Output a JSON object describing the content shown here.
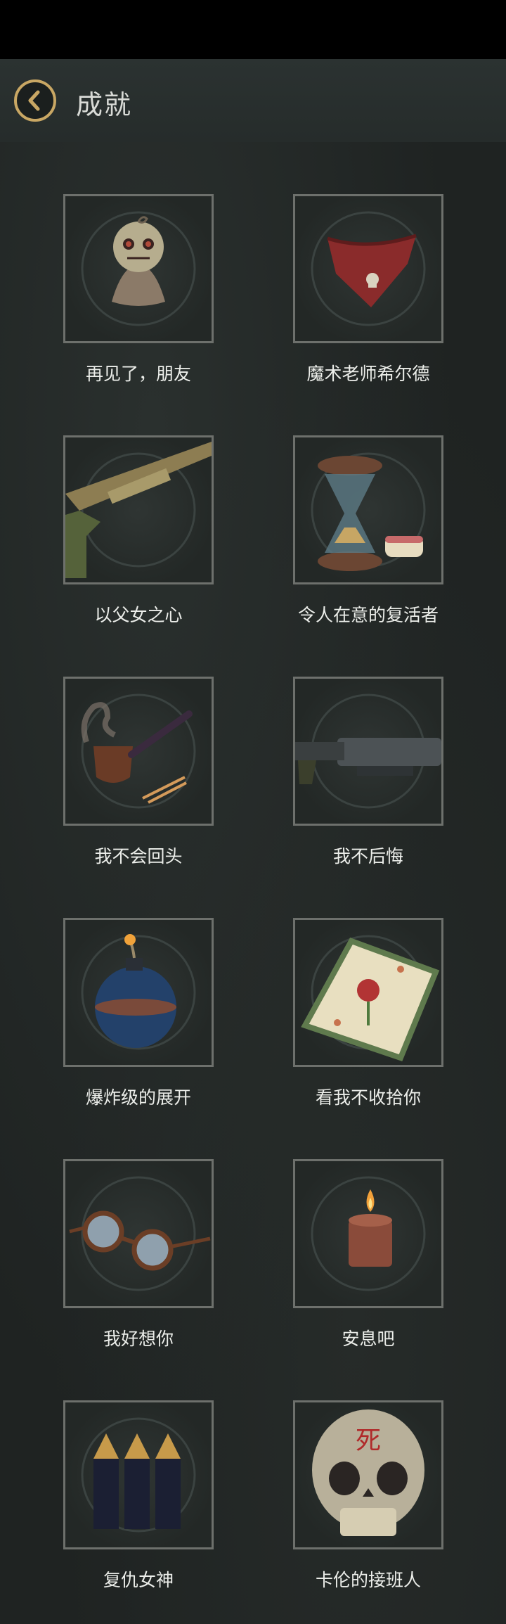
{
  "header": {
    "title": "成就"
  },
  "achievements": [
    {
      "name": "再见了，朋友",
      "icon": "voodoo-doll-icon"
    },
    {
      "name": "魔术老师希尔德",
      "icon": "bandana-icon"
    },
    {
      "name": "以父女之心",
      "icon": "shotgun-icon"
    },
    {
      "name": "令人在意的复活者",
      "icon": "hourglass-dentures-icon"
    },
    {
      "name": "我不会回头",
      "icon": "pipe-icon"
    },
    {
      "name": "我不后悔",
      "icon": "rifle-icon"
    },
    {
      "name": "爆炸级的展开",
      "icon": "bomb-icon"
    },
    {
      "name": "看我不收拾你",
      "icon": "handkerchief-icon"
    },
    {
      "name": "我好想你",
      "icon": "glasses-icon"
    },
    {
      "name": "安息吧",
      "icon": "candle-icon"
    },
    {
      "name": "复仇女神",
      "icon": "bullets-icon"
    },
    {
      "name": "卡伦的接班人",
      "icon": "skull-icon"
    }
  ],
  "skull_mark": "死"
}
